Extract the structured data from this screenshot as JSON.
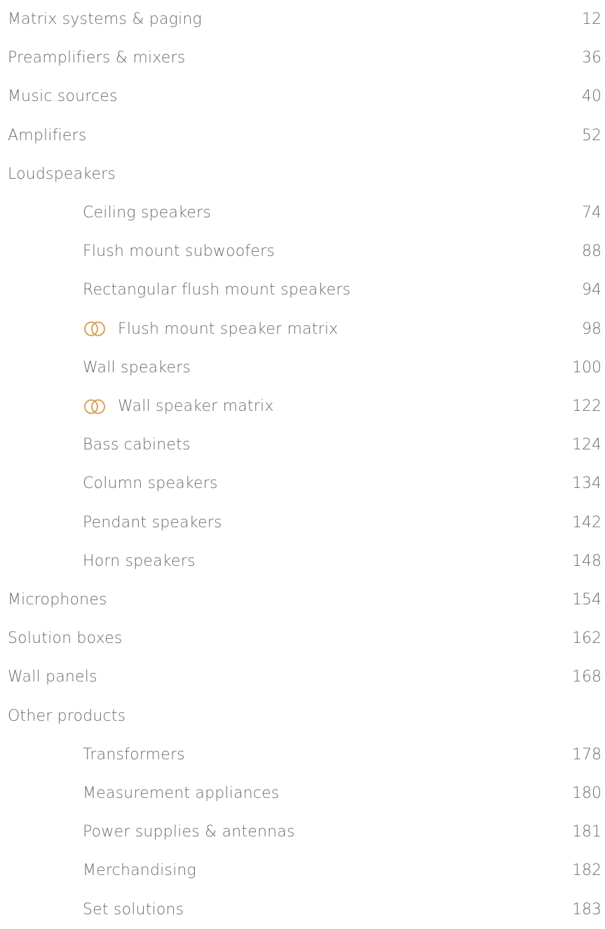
{
  "toc": {
    "entries": [
      {
        "label": "Matrix systems & paging",
        "page": "12",
        "level": 1,
        "icon": null
      },
      {
        "label": "Preamplifiers & mixers",
        "page": "36",
        "level": 1,
        "icon": null
      },
      {
        "label": "Music sources",
        "page": "40",
        "level": 1,
        "icon": null
      },
      {
        "label": "Amplifiers",
        "page": "52",
        "level": 1,
        "icon": null
      },
      {
        "label": "Loudspeakers",
        "page": "",
        "level": 1,
        "icon": null
      },
      {
        "label": "Ceiling speakers",
        "page": "74",
        "level": 2,
        "icon": null
      },
      {
        "label": "Flush mount subwoofers",
        "page": "88",
        "level": 2,
        "icon": null
      },
      {
        "label": "Rectangular flush mount speakers",
        "page": "94",
        "level": 2,
        "icon": null
      },
      {
        "label": "Flush mount speaker matrix",
        "page": "98",
        "level": 2,
        "icon": "interlocking-rings-icon"
      },
      {
        "label": "Wall speakers",
        "page": "100",
        "level": 2,
        "icon": null
      },
      {
        "label": "Wall speaker matrix",
        "page": "122",
        "level": 2,
        "icon": "interlocking-rings-icon"
      },
      {
        "label": "Bass cabinets",
        "page": "124",
        "level": 2,
        "icon": null
      },
      {
        "label": "Column speakers",
        "page": "134",
        "level": 2,
        "icon": null
      },
      {
        "label": "Pendant speakers",
        "page": "142",
        "level": 2,
        "icon": null
      },
      {
        "label": "Horn speakers",
        "page": "148",
        "level": 2,
        "icon": null
      },
      {
        "label": "Microphones",
        "page": "154",
        "level": 1,
        "icon": null
      },
      {
        "label": "Solution boxes",
        "page": "162",
        "level": 1,
        "icon": null
      },
      {
        "label": "Wall panels",
        "page": "168",
        "level": 1,
        "icon": null
      },
      {
        "label": "Other products",
        "page": "",
        "level": 1,
        "icon": null
      },
      {
        "label": "Transformers",
        "page": "178",
        "level": 2,
        "icon": null
      },
      {
        "label": "Measurement appliances",
        "page": "180",
        "level": 2,
        "icon": null
      },
      {
        "label": "Power supplies & antennas",
        "page": "181",
        "level": 2,
        "icon": null
      },
      {
        "label": "Merchandising",
        "page": "182",
        "level": 2,
        "icon": null
      },
      {
        "label": "Set solutions",
        "page": "183",
        "level": 2,
        "icon": null
      }
    ]
  },
  "colors": {
    "text": "#6b6b6b",
    "icon_accent": "#d9a25a"
  }
}
